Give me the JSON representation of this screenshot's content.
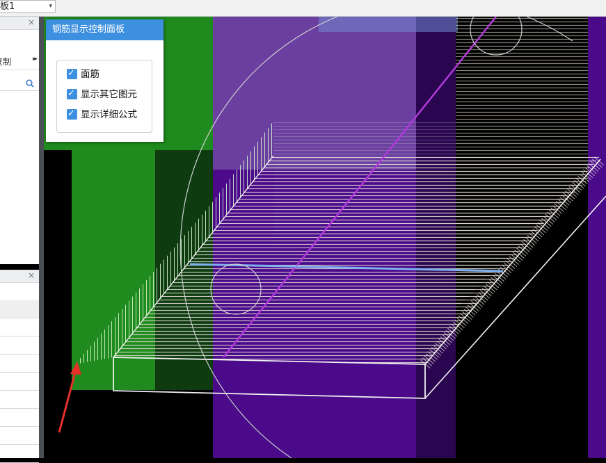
{
  "toolbar": {
    "floor_select": {
      "value": "板1",
      "arrow": "▾"
    }
  },
  "left_panel_top": {
    "close": "×",
    "row_label": "复制",
    "row_arrows": "▸▸"
  },
  "left_panel_bottom": {
    "close": "×"
  },
  "rebar_control_panel": {
    "title": "钢筋显示控制面板",
    "options": [
      {
        "label": "面筋",
        "checked": true
      },
      {
        "label": "显示其它图元",
        "checked": true
      },
      {
        "label": "显示详细公式",
        "checked": true
      }
    ]
  },
  "colors": {
    "panel_accent": "#3d8fe0",
    "green_element": "#1f8a1d",
    "purple_element": "#4a0a8a",
    "annotation_arrow": "#e8302a"
  }
}
